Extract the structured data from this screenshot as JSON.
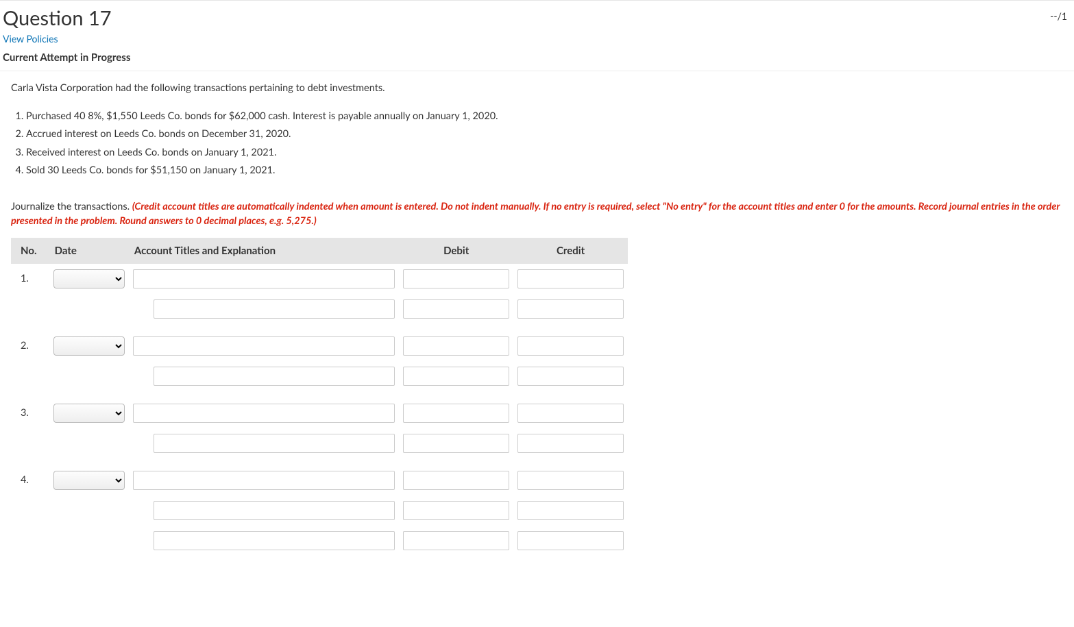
{
  "header": {
    "title": "Question 17",
    "score": "--/1",
    "policies_link": "View Policies",
    "attempt_status": "Current Attempt in Progress"
  },
  "body": {
    "intro": "Carla Vista Corporation had the following transactions pertaining to debt investments.",
    "transactions": [
      "Purchased 40 8%, $1,550 Leeds Co. bonds for $62,000 cash. Interest is payable annually on January 1, 2020.",
      "Accrued interest on Leeds Co. bonds on December 31, 2020.",
      "Received interest on Leeds Co. bonds on January 1, 2021.",
      "Sold 30 Leeds Co. bonds for $51,150 on January 1, 2021."
    ],
    "journalize_lead": "Journalize the transactions. ",
    "journalize_note": "(Credit account titles are automatically indented when amount is entered. Do not indent manually. If no entry is required, select \"No entry\" for the account titles and enter 0 for the amounts. Record journal entries in the order presented in the problem. Round answers to 0 decimal places, e.g. 5,275.)"
  },
  "table": {
    "headers": {
      "no": "No.",
      "date": "Date",
      "acct": "Account Titles and Explanation",
      "debit": "Debit",
      "credit": "Credit"
    },
    "row_labels": [
      "1.",
      "2.",
      "3.",
      "4."
    ]
  }
}
